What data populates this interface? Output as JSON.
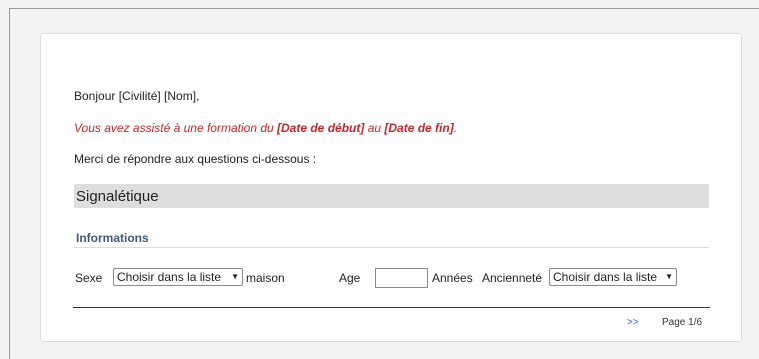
{
  "greeting": "Bonjour [Civilité] [Nom],",
  "formation": {
    "prefix": "Vous avez assisté à une formation du ",
    "start_date": "[Date de début]",
    "middle": " au ",
    "end_date": "[Date de fin]",
    "suffix": "."
  },
  "instructions": "Merci de répondre aux questions ci-dessous :",
  "section": {
    "title": "Signalétique",
    "subtitle": "Informations"
  },
  "fields": {
    "sexe_label": "Sexe",
    "sexe_select": "Choisir dans la liste",
    "maison_label": "maison",
    "age_label": "Age",
    "age_value": "",
    "annees_label": "Années",
    "anciennete_label": "Ancienneté",
    "anciennete_select": "Choisir dans la liste",
    "dropdown_arrow": "▼"
  },
  "footer": {
    "next_label": ">>",
    "page_label": "Page 1/6"
  }
}
